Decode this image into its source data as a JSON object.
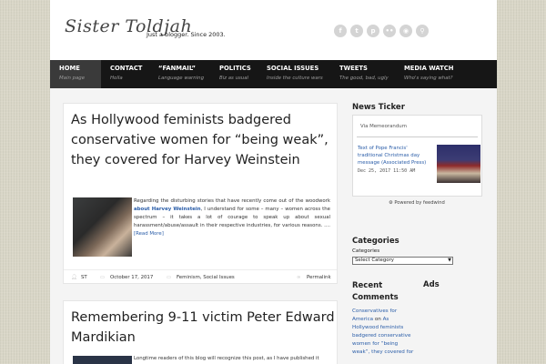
{
  "header": {
    "logo": "Sister Toldjah",
    "tagline": "Just a blogger. Since 2003.",
    "social_icons": [
      {
        "icon": "facebook-icon",
        "glyph": "f"
      },
      {
        "icon": "twitter-icon",
        "glyph": "t"
      },
      {
        "icon": "pinterest-icon",
        "glyph": "p"
      },
      {
        "icon": "flickr-icon",
        "glyph": "••"
      },
      {
        "icon": "rss-icon",
        "glyph": "◉"
      },
      {
        "icon": "search-icon",
        "glyph": "⚲"
      }
    ]
  },
  "nav": [
    {
      "label": "HOME",
      "sub": "Main page"
    },
    {
      "label": "CONTACT",
      "sub": "Holla"
    },
    {
      "label": "“FANMAIL”",
      "sub": "Language warning"
    },
    {
      "label": "POLITICS",
      "sub": "Biz as usual"
    },
    {
      "label": "SOCIAL ISSUES",
      "sub": "Inside the culture wars"
    },
    {
      "label": "TWEETS",
      "sub": "The good, bad, ugly"
    },
    {
      "label": "MEDIA WATCH",
      "sub": "Who's saying what?"
    }
  ],
  "posts": [
    {
      "title": "As Hollywood feminists badgered conservative women for “being weak”, they covered for Harvey Weinstein",
      "excerpt_before": "Regarding the disturbing stories that have recently come out of the woodwork ",
      "excerpt_link": "about Harvey Weinstein",
      "excerpt_after": ", I understand for some – many – women across the spectrum – it takes a lot of courage to speak up about sexual harassment/abuse/assault in their respective industries, for various reasons. ....  ",
      "read_more": "[Read More]",
      "author": "ST",
      "date": "October 17, 2017",
      "categories": "Feminism, Social Issues",
      "permalink": "Permalink"
    },
    {
      "title": "Remembering 9-11 victim Peter Edward Mardikian",
      "excerpt": "Longtime readers of this blog will recognize this post, as I have published it"
    }
  ],
  "sidebar": {
    "ticker_heading": "News Ticker",
    "ticker_source": "Via Memeorandum",
    "ticker_link": "Text of Pope Francis' traditional Christmas day message (Associated Press)",
    "ticker_date": "Dec 25, 2017 11:50 AM",
    "feedwind": "Powered by feedwind",
    "categories_heading": "Categories",
    "categories_label": "Categories",
    "categories_select": "Select Category",
    "recent_heading": "Recent Comments",
    "ads_heading": "Ads",
    "recent_comment": {
      "author": "Conservatives for America",
      "on": " on ",
      "post": "As Hollywood feminists badgered conservative women for “being weak”, they covered for"
    }
  }
}
